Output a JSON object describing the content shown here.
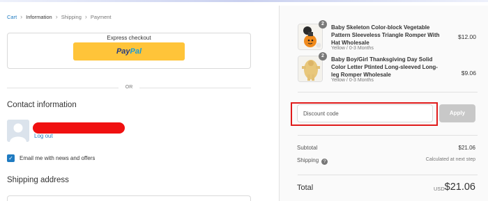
{
  "breadcrumb": {
    "items": [
      "Cart",
      "Information",
      "Shipping",
      "Payment"
    ]
  },
  "express": {
    "title": "Express checkout",
    "paypal_pay": "Pay",
    "paypal_pal": "Pal",
    "or_text": "OR"
  },
  "contact": {
    "title": "Contact information",
    "logout": "Log out",
    "email_opt_in": "Email me with news and offers",
    "email_opt_in_checked": true
  },
  "shipping": {
    "title": "Shipping address"
  },
  "order": {
    "items": [
      {
        "quantity": "2",
        "name": "Baby Skeleton Color-block Vegetable Pattern Sleeveless Triangle Romper With Hat Wholesale",
        "variant": "Yellow / 0-3 Months",
        "price": "$12.00"
      },
      {
        "quantity": "2",
        "name": "Baby Boy/Girl Thanksgiving Day Solid Color Letter Ptinted Long-sleeved Long-leg Romper Wholesale",
        "variant": "Yellow / 0-3 Months",
        "price": "$9.06"
      }
    ],
    "discount_placeholder": "Discount code",
    "apply_label": "Apply",
    "subtotal_label": "Subtotal",
    "subtotal_value": "$21.06",
    "shipping_label": "Shipping",
    "shipping_value": "Calculated at next step",
    "total_label": "Total",
    "total_currency": "USD",
    "total_value": "$21.06"
  },
  "colors": {
    "link": "#1f7bc1",
    "paypal_yellow": "#ffc439",
    "highlight_red": "#e01b1b"
  }
}
